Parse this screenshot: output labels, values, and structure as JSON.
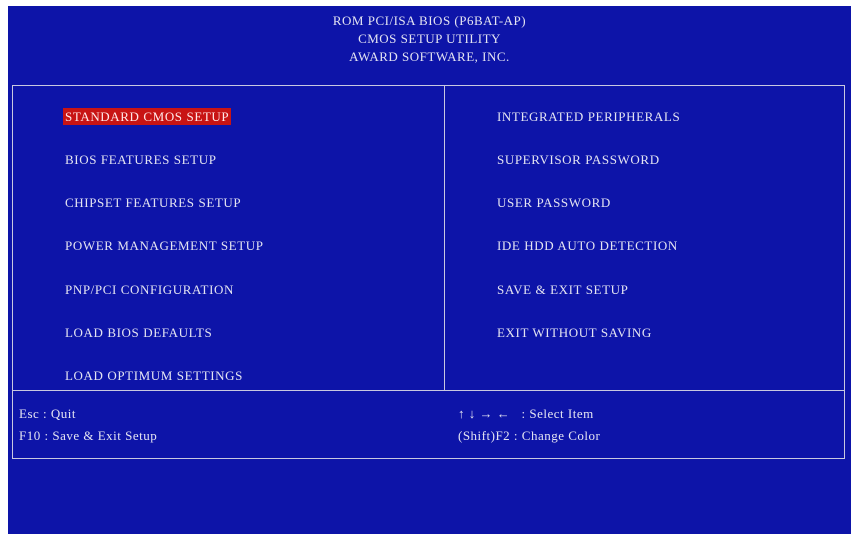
{
  "header": {
    "line1": "ROM PCI/ISA BIOS (P6BAT-AP)",
    "line2": "CMOS SETUP UTILITY",
    "line3": "AWARD SOFTWARE, INC."
  },
  "menu": {
    "left": [
      "STANDARD CMOS SETUP",
      "BIOS FEATURES SETUP",
      "CHIPSET FEATURES SETUP",
      "POWER MANAGEMENT SETUP",
      "PNP/PCI CONFIGURATION",
      "LOAD BIOS DEFAULTS",
      "LOAD OPTIMUM SETTINGS"
    ],
    "right": [
      "INTEGRATED PERIPHERALS",
      "SUPERVISOR PASSWORD",
      "USER PASSWORD",
      "IDE HDD AUTO DETECTION",
      "SAVE & EXIT SETUP",
      "EXIT WITHOUT SAVING"
    ],
    "selected": "STANDARD CMOS SETUP"
  },
  "help": {
    "esc": "Esc : Quit",
    "f10": "F10 : Save & Exit Setup",
    "arrows": "↑ ↓ → ←   : Select Item",
    "shift_f2": "(Shift)F2 : Change Color"
  },
  "colors": {
    "background": "#0d14a8",
    "text": "#e4e4f2",
    "highlight": "#c81414",
    "border": "#c8c8e0"
  }
}
